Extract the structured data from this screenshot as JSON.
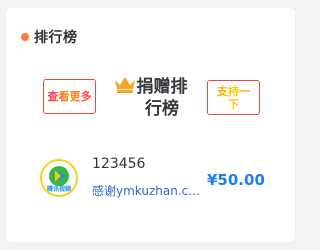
{
  "colors": {
    "accent_dot": "#f77b3c",
    "button_border": "#e34b4b",
    "amount": "#1f7ff0",
    "crown": "#f5a623",
    "avatar_border": "#f4d21f"
  },
  "header": {
    "title": "排行榜"
  },
  "board": {
    "title": "捐赠排行榜",
    "more_button": "查看更多",
    "support_button": "支持一下",
    "crown_icon": "crown-icon"
  },
  "donations": [
    {
      "name": "123456",
      "message": "感谢ymkuzhan.com",
      "amount": "¥50.00",
      "avatar_icon": "video-player-avatar",
      "avatar_caption": "腾讯视频"
    }
  ]
}
